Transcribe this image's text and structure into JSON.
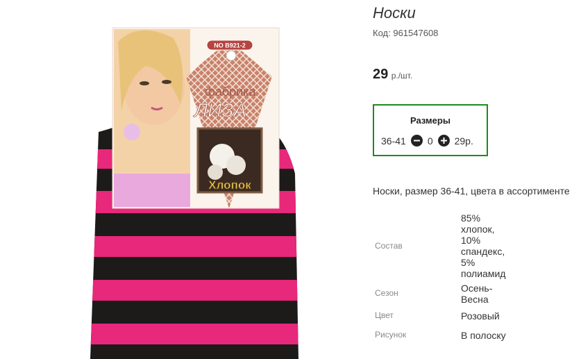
{
  "product": {
    "title": "Носки",
    "code_label": "Код:",
    "code_value": "961547608",
    "price_value": "29",
    "price_unit": "р./шт.",
    "sizes": {
      "title": "Размеры",
      "row": {
        "size": "36-41",
        "quantity": "0",
        "price": "29р.",
        "minus_icon": "minus-circle-icon",
        "plus_icon": "plus-circle-icon"
      }
    },
    "description": "Носки, размер 36-41, цвета в ассортименте",
    "attributes": [
      {
        "label": "Состав",
        "value": "85% хлопок, 10% спандекс, 5% полиамид"
      },
      {
        "label": "Сезон",
        "value": "Осень-Весна"
      },
      {
        "label": "Цвет",
        "value": "Розовый"
      },
      {
        "label": "Рисунок",
        "value": "В полоску"
      }
    ]
  },
  "image": {
    "tag_code": "NO B921-2",
    "brand_prefix": "фабрика",
    "brand_name": "ЛИЗА",
    "material": "Хлопок"
  },
  "colors": {
    "accent_border": "#1e8a1e",
    "stripe_pink": "#e8287a",
    "stripe_black": "#1d1a1a"
  }
}
